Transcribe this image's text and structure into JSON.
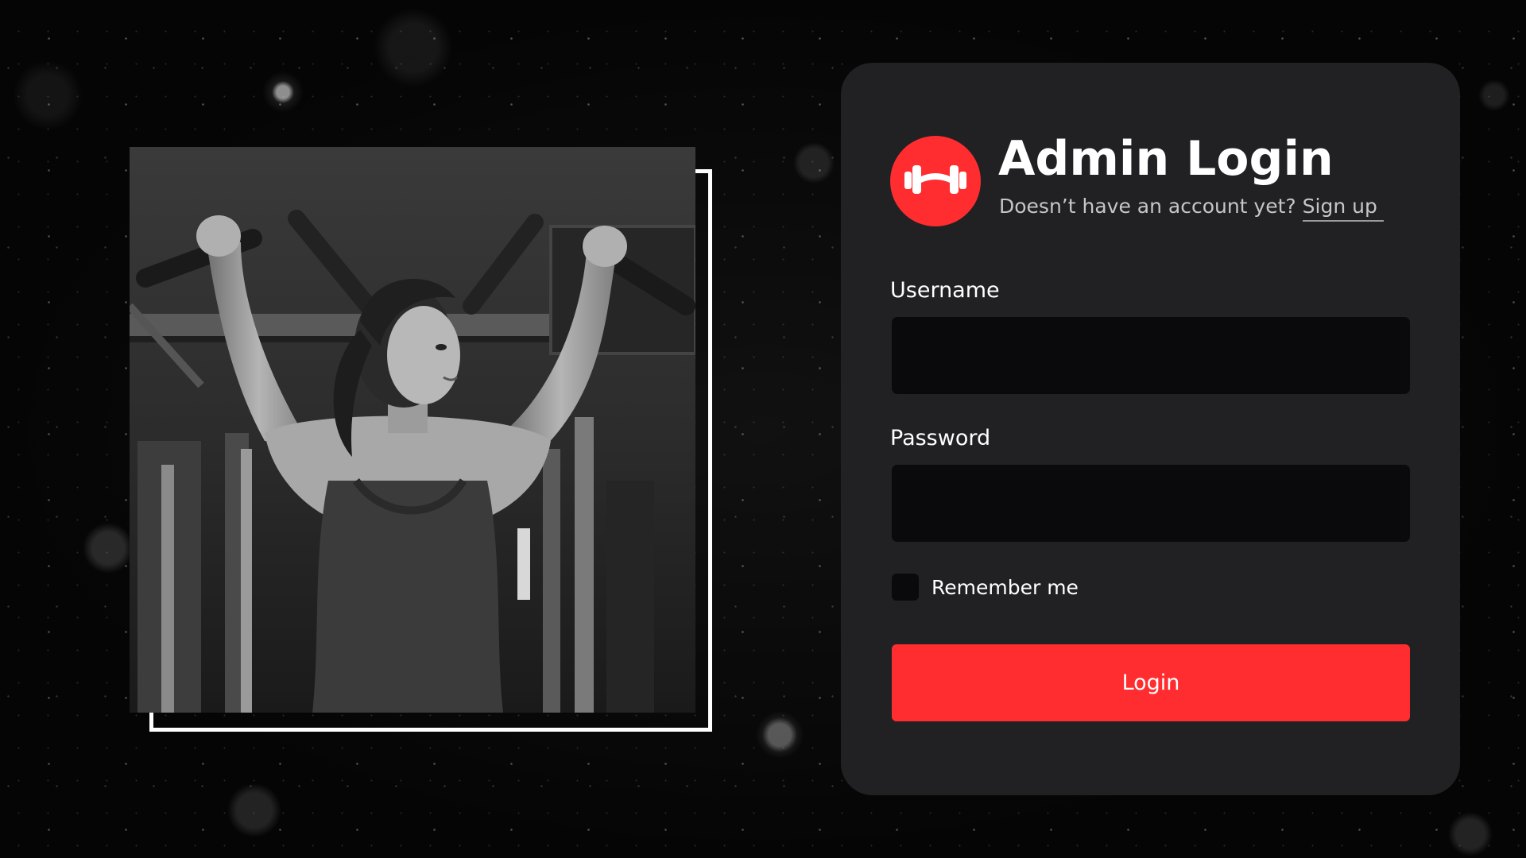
{
  "login_card": {
    "title": "Admin Login",
    "subtitle_prefix": "Doesn’t have an account yet?",
    "signup_link": "Sign up",
    "username_label": "Username",
    "username_value": "",
    "password_label": "Password",
    "password_value": "",
    "remember_label": "Remember me",
    "remember_checked": false,
    "login_button": "Login"
  },
  "logo": {
    "icon": "dumbbell-icon",
    "color": "#ff2d2f"
  },
  "photo": {
    "description_icon": "woman-pull-up-photo"
  },
  "colors": {
    "background": "#050505",
    "card": "#212124",
    "input": "#0a0a0c",
    "accent": "#ff2d2f",
    "text": "#ffffff",
    "muted_text": "#c6c6c9"
  }
}
